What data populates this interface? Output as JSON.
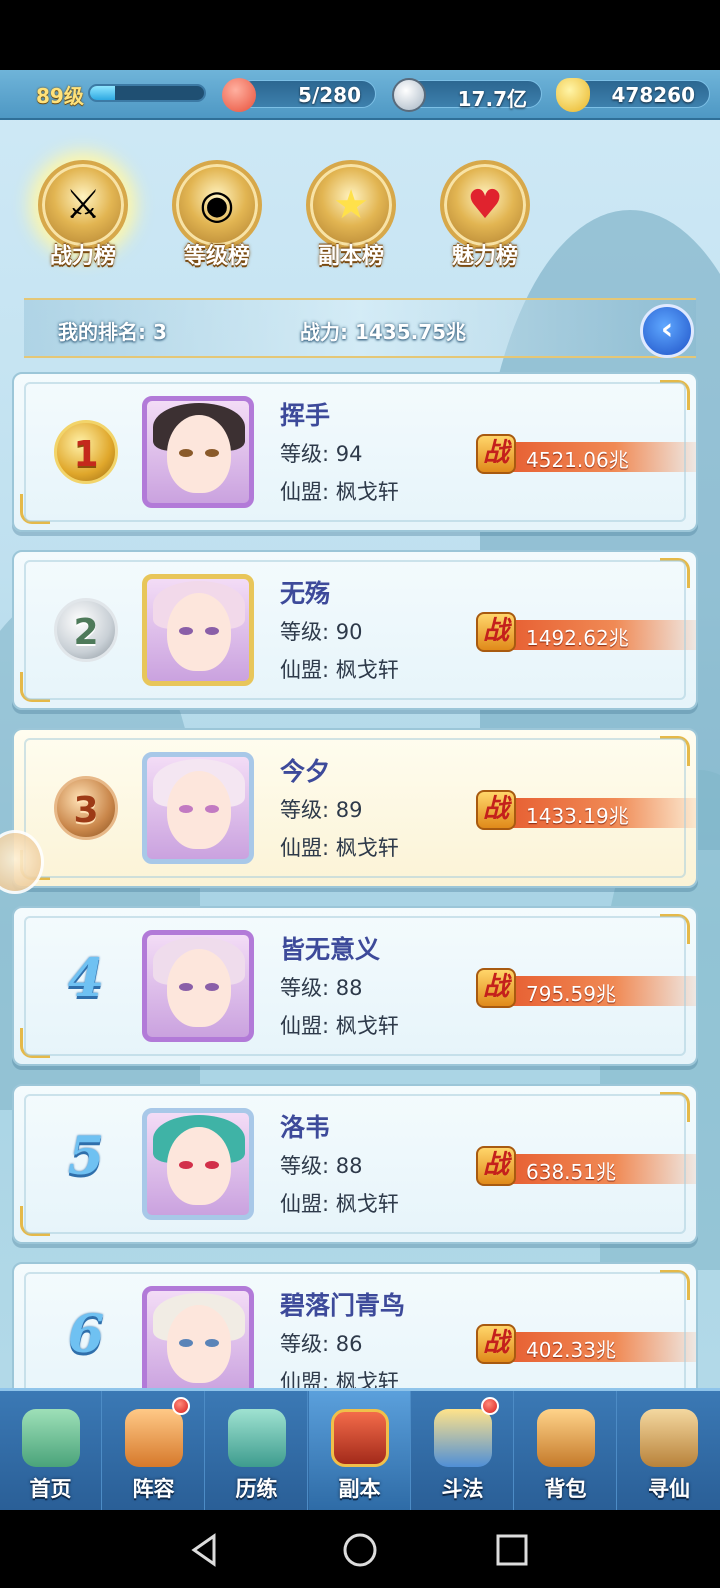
{
  "topbar": {
    "level": "89级",
    "xp_fraction": 0.22,
    "stamina": "5/280",
    "coins": "17.7亿",
    "ingots": "478260"
  },
  "tabs": [
    {
      "label": "战力榜",
      "icon": "sword-icon",
      "active": true
    },
    {
      "label": "等级榜",
      "icon": "drum-icon",
      "active": false
    },
    {
      "label": "副本榜",
      "icon": "star-icon",
      "active": false
    },
    {
      "label": "魅力榜",
      "icon": "heart-icon",
      "active": false
    }
  ],
  "myrank": {
    "rank_label": "我的排名: 3",
    "power_label": "战力: 1435.75兆"
  },
  "ranking": [
    {
      "rank": "1",
      "name": "挥手",
      "level": "等级: 94",
      "guild": "仙盟: 枫戈轩",
      "power": "4521.06兆"
    },
    {
      "rank": "2",
      "name": "无殇",
      "level": "等级: 90",
      "guild": "仙盟: 枫戈轩",
      "power": "1492.62兆"
    },
    {
      "rank": "3",
      "name": "今夕",
      "level": "等级: 89",
      "guild": "仙盟: 枫戈轩",
      "power": "1433.19兆"
    },
    {
      "rank": "4",
      "name": "皆无意义",
      "level": "等级: 88",
      "guild": "仙盟: 枫戈轩",
      "power": "795.59兆"
    },
    {
      "rank": "5",
      "name": "洛韦",
      "level": "等级: 88",
      "guild": "仙盟: 枫戈轩",
      "power": "638.51兆"
    },
    {
      "rank": "6",
      "name": "碧落门青鸟",
      "level": "等级: 86",
      "guild": "仙盟: 枫戈轩",
      "power": "402.33兆"
    }
  ],
  "power_badge": "战",
  "bottomnav": [
    {
      "label": "首页",
      "icon": "home-icon",
      "dot": false
    },
    {
      "label": "阵容",
      "icon": "lineup-icon",
      "dot": true
    },
    {
      "label": "历练",
      "icon": "training-icon",
      "dot": false
    },
    {
      "label": "副本",
      "icon": "dungeon-gate-icon",
      "dot": false
    },
    {
      "label": "斗法",
      "icon": "battle-icon",
      "dot": true
    },
    {
      "label": "背包",
      "icon": "bag-icon",
      "dot": false
    },
    {
      "label": "寻仙",
      "icon": "scroll-icon",
      "dot": false
    }
  ],
  "colors": {
    "accent_gold": "#e5b949",
    "power_red": "#e65a2e",
    "name_blue": "#3d4a9a"
  }
}
